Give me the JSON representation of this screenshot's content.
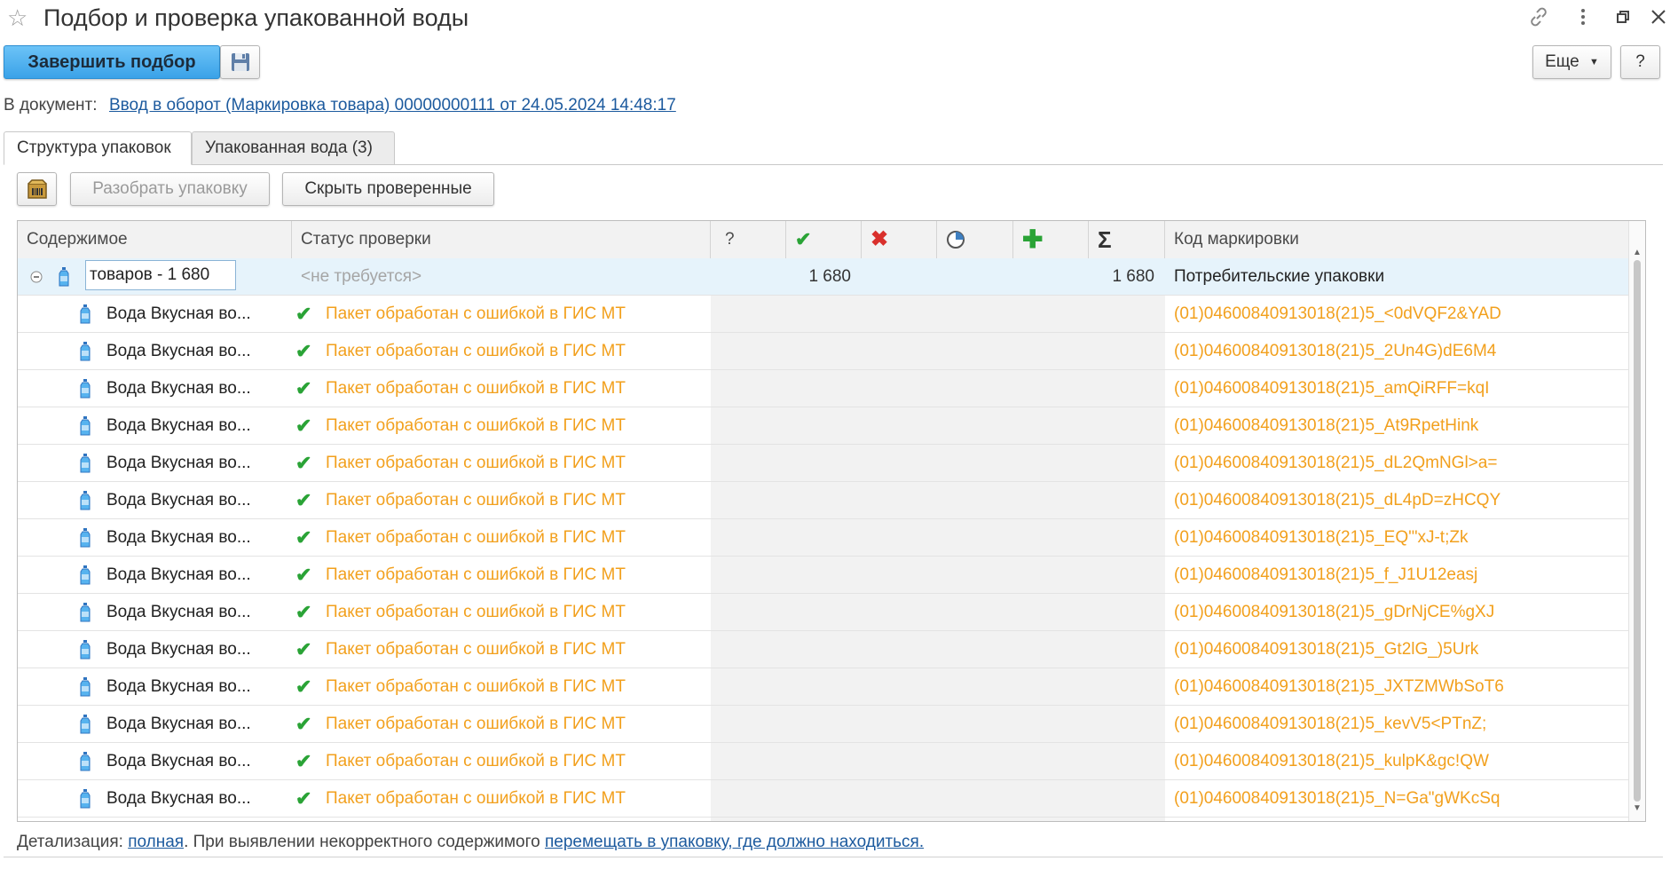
{
  "window": {
    "title": "Подбор и проверка упакованной воды"
  },
  "toolbar": {
    "finish_label": "Завершить подбор",
    "more_label": "Еще",
    "help_label": "?"
  },
  "document": {
    "label": "В документ:",
    "link": "Ввод в оборот (Маркировка товара) 00000000111 от 24.05.2024 14:48:17"
  },
  "tabs": [
    {
      "label": "Структура упаковок",
      "active": true
    },
    {
      "label": "Упакованная вода (3)",
      "active": false
    }
  ],
  "subtoolbar": {
    "unpack_label": "Разобрать упаковку",
    "hide_checked_label": "Скрыть проверенные"
  },
  "table": {
    "columns": [
      "Содержимое",
      "Статус проверки",
      "?",
      "",
      "",
      "",
      "",
      "",
      "Код маркировки"
    ],
    "group_row": {
      "content": "товаров - 1 680",
      "status": "<не требуется>",
      "checked": "1 680",
      "total": "1 680",
      "code": "Потребительские упаковки"
    },
    "rows": [
      {
        "content": "Вода Вкусная во...",
        "status": "Пакет обработан с ошибкой в ГИС МТ",
        "code": "(01)04600840913018(21)5_<0dVQF2&YAD"
      },
      {
        "content": "Вода Вкусная во...",
        "status": "Пакет обработан с ошибкой в ГИС МТ",
        "code": "(01)04600840913018(21)5_2Un4G)dE6M4"
      },
      {
        "content": "Вода Вкусная во...",
        "status": "Пакет обработан с ошибкой в ГИС МТ",
        "code": "(01)04600840913018(21)5_amQiRFF=kqI"
      },
      {
        "content": "Вода Вкусная во...",
        "status": "Пакет обработан с ошибкой в ГИС МТ",
        "code": "(01)04600840913018(21)5_At9RpetHink"
      },
      {
        "content": "Вода Вкусная во...",
        "status": "Пакет обработан с ошибкой в ГИС МТ",
        "code": "(01)04600840913018(21)5_dL2QmNGl>a="
      },
      {
        "content": "Вода Вкусная во...",
        "status": "Пакет обработан с ошибкой в ГИС МТ",
        "code": "(01)04600840913018(21)5_dL4pD=zHCQY"
      },
      {
        "content": "Вода Вкусная во...",
        "status": "Пакет обработан с ошибкой в ГИС МТ",
        "code": "(01)04600840913018(21)5_EQ'\"xJ-t;Zk"
      },
      {
        "content": "Вода Вкусная во...",
        "status": "Пакет обработан с ошибкой в ГИС МТ",
        "code": "(01)04600840913018(21)5_f_J1U12easj"
      },
      {
        "content": "Вода Вкусная во...",
        "status": "Пакет обработан с ошибкой в ГИС МТ",
        "code": "(01)04600840913018(21)5_gDrNjCE%gXJ"
      },
      {
        "content": "Вода Вкусная во...",
        "status": "Пакет обработан с ошибкой в ГИС МТ",
        "code": "(01)04600840913018(21)5_Gt2lG_)5Urk"
      },
      {
        "content": "Вода Вкусная во...",
        "status": "Пакет обработан с ошибкой в ГИС МТ",
        "code": "(01)04600840913018(21)5_JXTZMWbSoT6"
      },
      {
        "content": "Вода Вкусная во...",
        "status": "Пакет обработан с ошибкой в ГИС МТ",
        "code": "(01)04600840913018(21)5_kevV5<PTnZ;"
      },
      {
        "content": "Вода Вкусная во...",
        "status": "Пакет обработан с ошибкой в ГИС МТ",
        "code": "(01)04600840913018(21)5_kulpK&gc!QW"
      },
      {
        "content": "Вода Вкусная во...",
        "status": "Пакет обработан с ошибкой в ГИС МТ",
        "code": "(01)04600840913018(21)5_N=Ga\"gWKcSq"
      }
    ]
  },
  "footer": {
    "detail_label": "Детализация:",
    "detail_link": "полная",
    "text": ". При выявлении некорректного содержимого",
    "action_link": "перемещать в упаковку, где должно находиться."
  },
  "colors": {
    "accent": "#3aa2e8",
    "warning": "#f2a01d",
    "success": "#2aa336",
    "error": "#d9302c",
    "link": "#1c5a9e"
  }
}
